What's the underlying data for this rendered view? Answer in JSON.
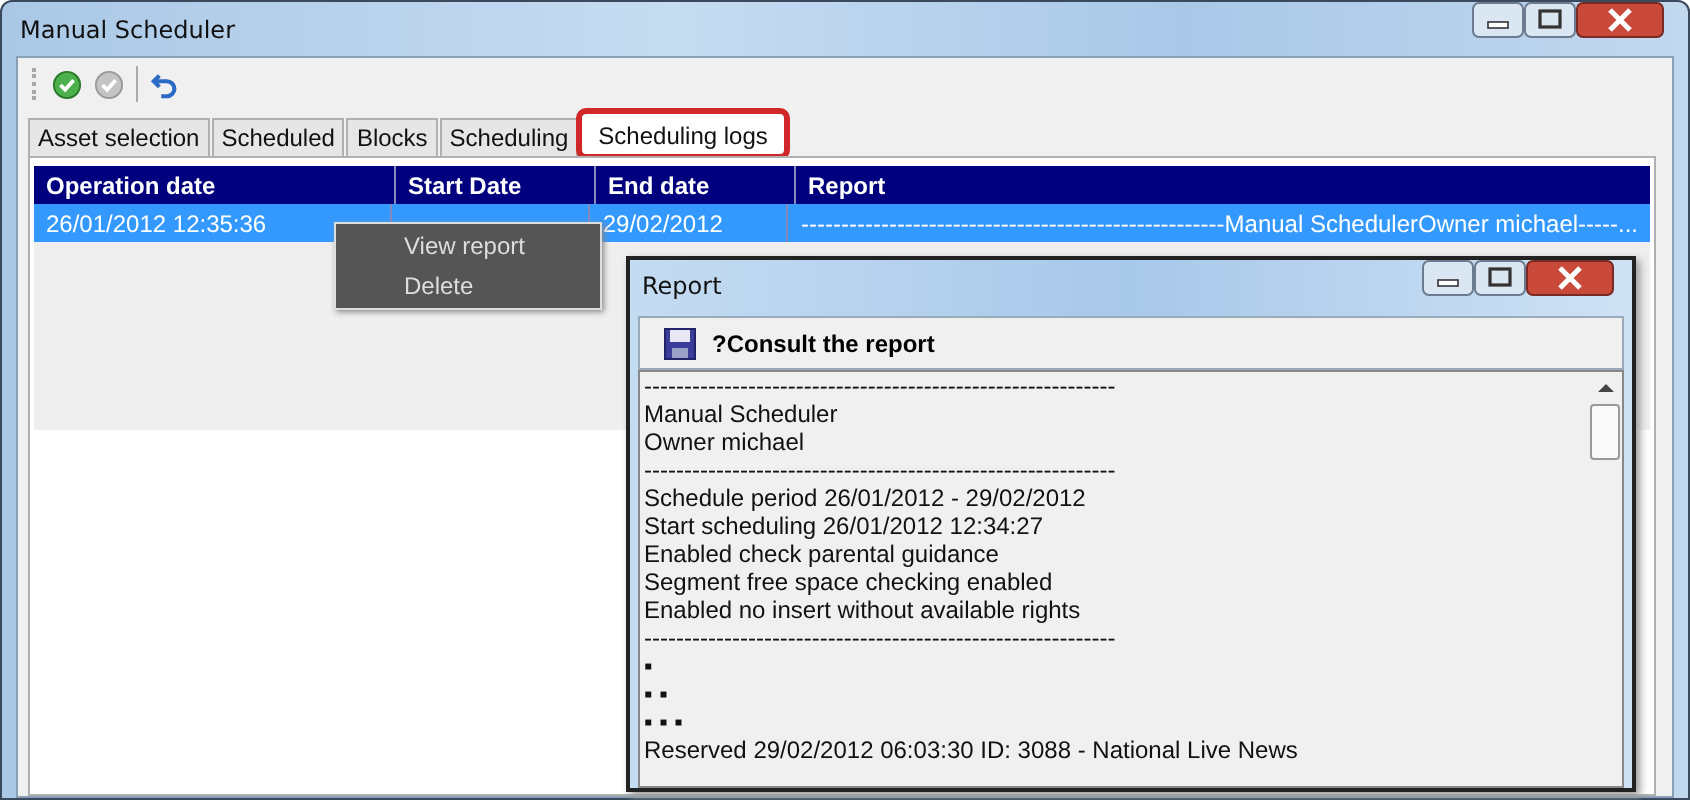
{
  "window": {
    "title": "Manual Scheduler"
  },
  "toolbar": [
    {
      "kind": "ok",
      "disabled": false
    },
    {
      "kind": "ok",
      "disabled": true
    },
    {
      "kind": "undo",
      "disabled": false
    }
  ],
  "tabs": [
    {
      "label": "Asset selection",
      "selected": false
    },
    {
      "label": "Scheduled",
      "selected": false
    },
    {
      "label": "Blocks",
      "selected": false
    },
    {
      "label": "Scheduling",
      "selected": false
    },
    {
      "label": "Scheduling logs",
      "selected": true,
      "highlighted": true
    }
  ],
  "table": {
    "columns": [
      "Operation date",
      "Start Date",
      "End date",
      "Report"
    ],
    "rows": [
      {
        "selected": true,
        "operation_date": "26/01/2012 12:35:36",
        "end_date": "29/02/2012",
        "report": "-----------------------------------------------------Manual SchedulerOwner michael-----..."
      }
    ]
  },
  "context_menu": {
    "items": [
      "View report",
      "Delete"
    ]
  },
  "report_window": {
    "title": "Report",
    "toolbar_label": "?Consult the report",
    "lines": [
      "-----------------------------------------------------------",
      "Manual Scheduler",
      "Owner michael",
      "-----------------------------------------------------------",
      "Schedule period 26/01/2012 - 29/02/2012",
      "Start scheduling 26/01/2012 12:34:27",
      "Enabled check parental guidance",
      "Segment free space checking enabled",
      "Enabled no insert without available rights",
      "-----------------------------------------------------------",
      "▪",
      "▪ ▪",
      "▪ ▪ ▪",
      "Reserved 29/02/2012 06:03:30  ID: 3088 - National Live News"
    ]
  }
}
